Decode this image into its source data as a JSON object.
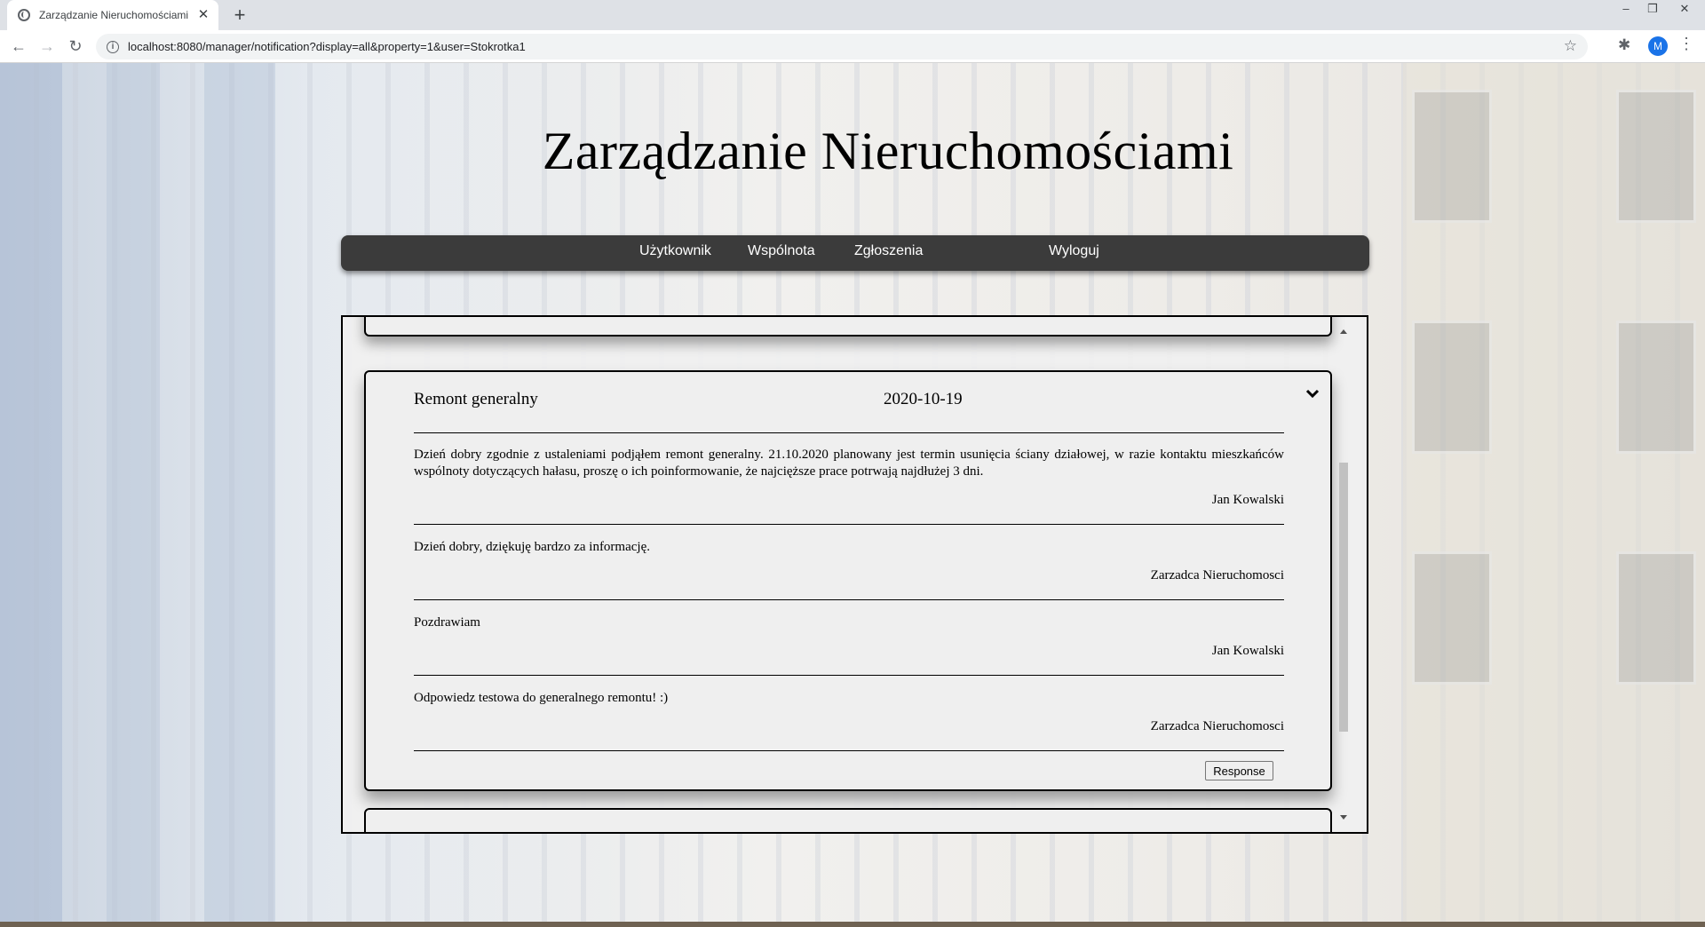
{
  "browser": {
    "tab_title": "Zarządzanie Nieruchomościami",
    "url": "localhost:8080/manager/notification?display=all&property=1&user=Stokrotka1",
    "profile_initial": "M"
  },
  "site": {
    "title": "Zarządzanie Nieruchomościami"
  },
  "nav": {
    "items": [
      {
        "label": "Użytkownik"
      },
      {
        "label": "Wspólnota"
      },
      {
        "label": "Zgłoszenia"
      },
      {
        "label": "Wyloguj"
      }
    ]
  },
  "notification": {
    "title": "Remont generalny",
    "date": "2020-10-19",
    "messages": [
      {
        "text": "Dzień dobry zgodnie z ustaleniami podjąłem remont generalny. 21.10.2020 planowany jest termin usunięcia ściany działowej, w razie kontaktu mieszkańców wspólnoty dotyczących hałasu, proszę o ich poinformowanie, że najcięższe prace potrwają najdłużej 3 dni.",
        "author": "Jan Kowalski"
      },
      {
        "text": "Dzień dobry, dziękuję bardzo za informację.",
        "author": "Zarzadca Nieruchomosci"
      },
      {
        "text": "Pozdrawiam",
        "author": "Jan Kowalski"
      },
      {
        "text": "Odpowiedz testowa do generalnego remontu! :)",
        "author": "Zarzadca Nieruchomosci"
      }
    ],
    "response_label": "Response"
  },
  "colors": {
    "nav_bg": "#3b3b3b",
    "nav_text": "#ffffff",
    "panel_bg": "#efefef",
    "avatar": "#1a73e8"
  }
}
